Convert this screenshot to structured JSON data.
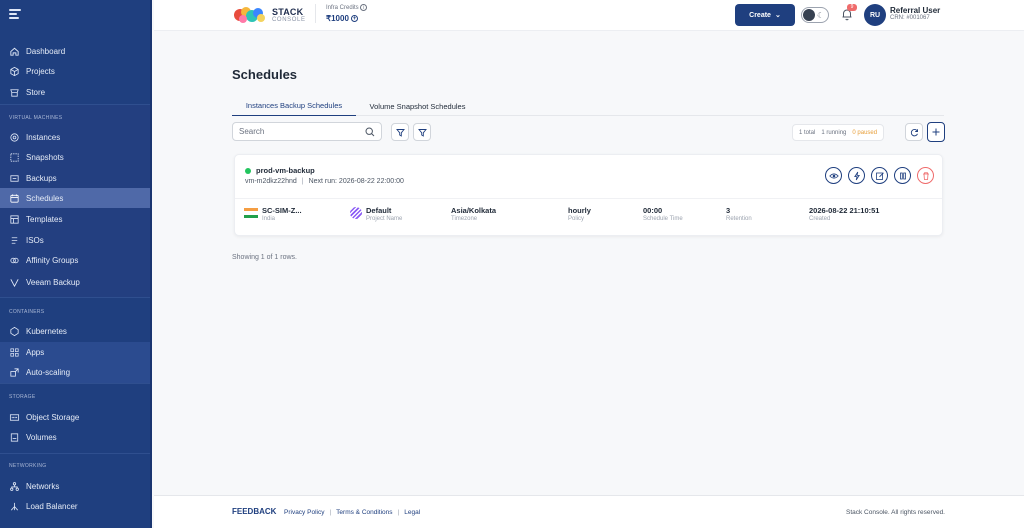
{
  "sidebar": {
    "menu_icon": "hamburger-icon",
    "top_items": [
      {
        "label": "Dashboard",
        "icon": "home-icon"
      },
      {
        "label": "Projects",
        "icon": "cube-icon"
      },
      {
        "label": "Store",
        "icon": "store-icon"
      }
    ],
    "sections": [
      {
        "title": "VIRTUAL MACHINES",
        "items": [
          {
            "label": "Instances",
            "icon": "instance-icon"
          },
          {
            "label": "Snapshots",
            "icon": "snapshot-icon"
          },
          {
            "label": "Backups",
            "icon": "backup-icon"
          },
          {
            "label": "Schedules",
            "icon": "calendar-icon",
            "active": true
          },
          {
            "label": "Templates",
            "icon": "template-icon"
          },
          {
            "label": "ISOs",
            "icon": "iso-icon"
          },
          {
            "label": "Affinity Groups",
            "icon": "affinity-icon"
          },
          {
            "label": "Veeam Backup",
            "icon": "veeam-icon"
          }
        ]
      },
      {
        "title": "CONTAINERS",
        "items": [
          {
            "label": "Kubernetes",
            "icon": "kubernetes-icon"
          },
          {
            "label": "Apps",
            "icon": "apps-icon"
          },
          {
            "label": "Auto-scaling",
            "icon": "autoscale-icon"
          }
        ]
      },
      {
        "title": "STORAGE",
        "items": [
          {
            "label": "Object Storage",
            "icon": "object-storage-icon"
          },
          {
            "label": "Volumes",
            "icon": "volume-icon"
          }
        ]
      },
      {
        "title": "NETWORKING",
        "items": [
          {
            "label": "Networks",
            "icon": "network-icon"
          },
          {
            "label": "Load Balancer",
            "icon": "load-balancer-icon"
          }
        ]
      }
    ]
  },
  "header": {
    "logo_line1": "STACK",
    "logo_line2": "CONSOLE",
    "credits_label": "Infra Credits",
    "credits_value": "₹1000",
    "create_label": "Create",
    "notifications_count": "9",
    "avatar_initials": "RU",
    "user_name": "Referral User",
    "user_crn": "CRN: #001067"
  },
  "main": {
    "title": "Schedules",
    "tabs": [
      {
        "label": "Instances Backup Schedules",
        "active": true
      },
      {
        "label": "Volume Snapshot Schedules",
        "active": false
      }
    ],
    "search_placeholder": "Search",
    "stats": {
      "total": "1 total",
      "running": "1 running",
      "paused": "0 paused"
    },
    "schedules": [
      {
        "name": "prod-vm-backup",
        "status_color": "#22c55e",
        "vm": "vm-m2dkz22hnd",
        "next_run": "Next run: 2026-08-22 22:00:00",
        "region": {
          "value": "SC-SIM-Z...",
          "label": "India"
        },
        "project": {
          "value": "Default",
          "label": "Project Name"
        },
        "timezone": {
          "value": "Asia/Kolkata",
          "label": "Timezone"
        },
        "policy": {
          "value": "hourly",
          "label": "Policy"
        },
        "schedule_time": {
          "value": "00:00",
          "label": "Schedule Time"
        },
        "retention": {
          "value": "3",
          "label": "Retention"
        },
        "created": {
          "value": "2026-08-22 21:10:51",
          "label": "Created"
        }
      }
    ],
    "showing": "Showing 1 of 1 rows."
  },
  "footer": {
    "feedback": "FEEDBACK",
    "links": [
      "Privacy Policy",
      "Terms & Conditions",
      "Legal"
    ],
    "copyright": "Stack Console. All rights reserved."
  },
  "colors": {
    "brand": "#1f3f7f",
    "sidebar_bg": "#1f3f7f",
    "active_item": "#4f69a8",
    "danger": "#ef6b6b",
    "running": "#22c55e",
    "paused": "#e79f3a"
  }
}
